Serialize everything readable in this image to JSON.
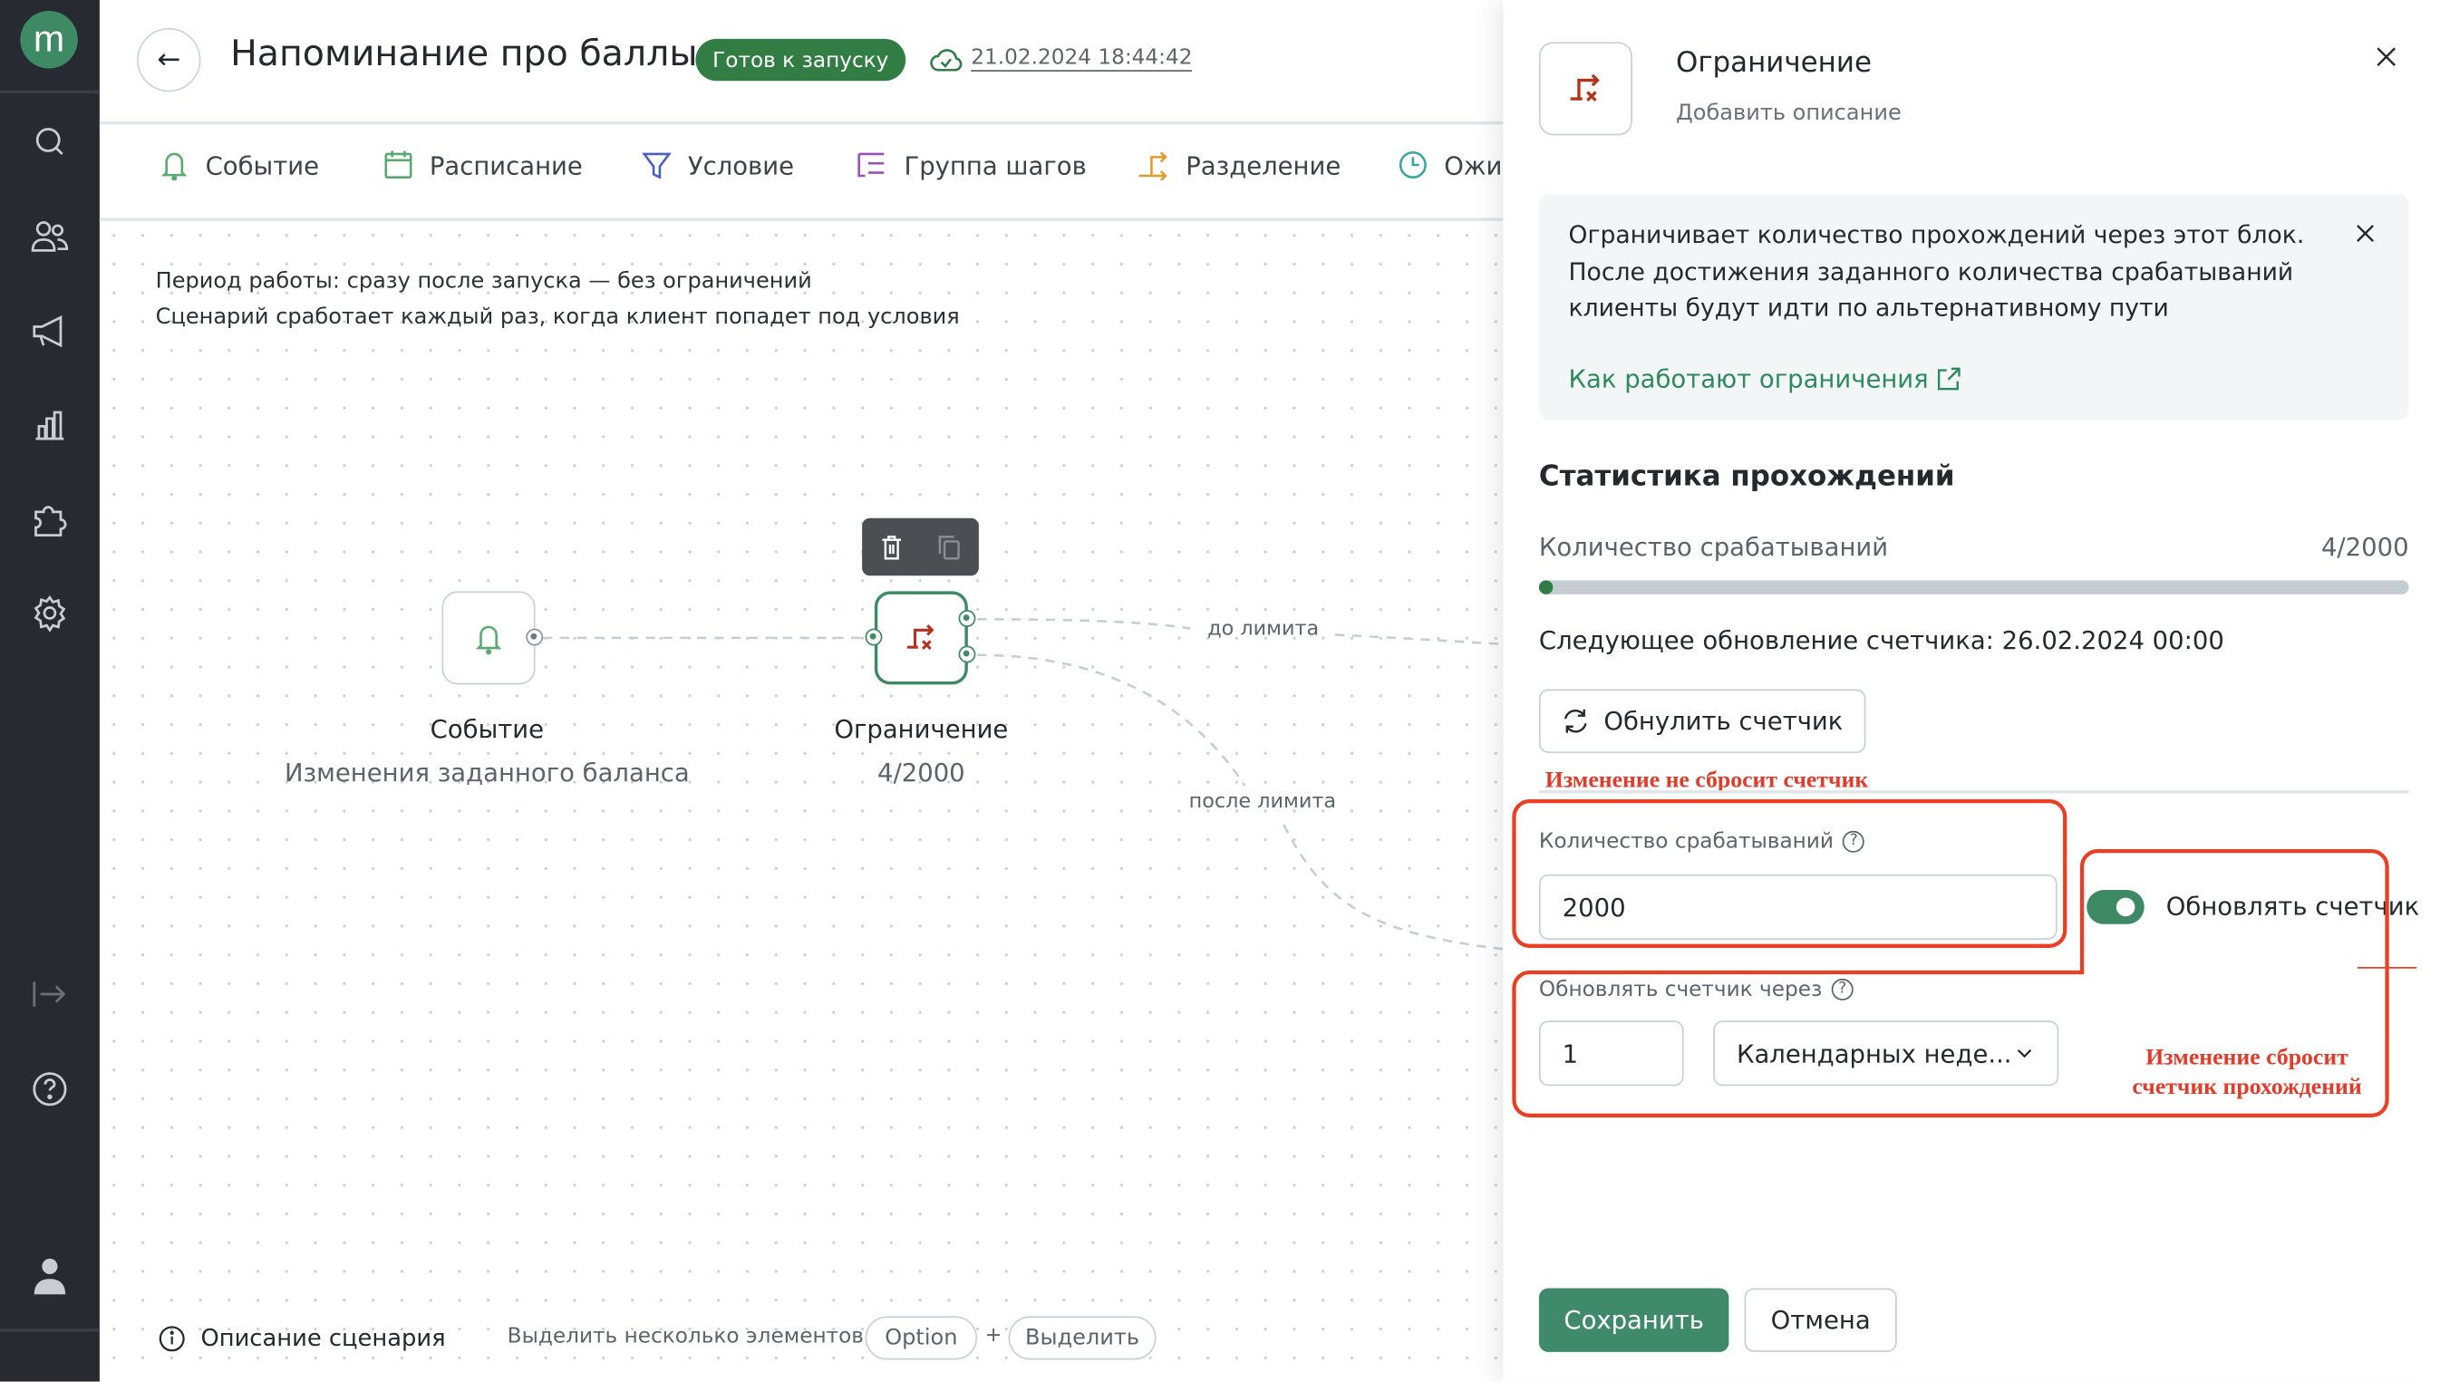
{
  "sidebar": {
    "logo": "m",
    "icons": [
      "search-icon",
      "users-icon",
      "megaphone-icon",
      "chart-icon",
      "puzzle-icon",
      "gear-icon",
      "logout-icon",
      "help-icon",
      "user-icon"
    ]
  },
  "header": {
    "title": "Напоминание про баллы",
    "status": "Готов к запуску",
    "saved_at": "21.02.2024 18:44:42"
  },
  "tabs": [
    {
      "label": "Событие",
      "color": "#5aa96f"
    },
    {
      "label": "Расписание",
      "color": "#5aa96f"
    },
    {
      "label": "Условие",
      "color": "#4a5fc1"
    },
    {
      "label": "Группа шагов",
      "color": "#9b4fb8"
    },
    {
      "label": "Разделение",
      "color": "#e39a2a"
    },
    {
      "label": "Ожи",
      "color": "#3aa3a3"
    }
  ],
  "canvas": {
    "period": "Период работы: сразу после запуска — без ограничений",
    "trigger": "Сценарий сработает каждый раз, когда клиент попадет под условия",
    "nodes": [
      {
        "title": "Событие",
        "subtitle": "Изменения заданного баланса"
      },
      {
        "title": "Ограничение",
        "subtitle": "4/2000"
      }
    ],
    "edges": {
      "before": "до лимита",
      "after": "после лимита"
    }
  },
  "footer": {
    "description": "Описание сценария",
    "multi_select": "Выделить несколько элементов",
    "key": "Option",
    "plus": "+",
    "action": "Выделить"
  },
  "panel": {
    "title": "Ограничение",
    "description_placeholder": "Добавить описание",
    "info": {
      "lines": [
        "Ограничивает количество прохождений через этот блок.",
        "После достижения заданного количества срабатываний",
        "клиенты будут идти по альтернативному пути"
      ],
      "link": "Как работают ограничения"
    },
    "stats": {
      "heading": "Статистика прохождений",
      "label": "Количество срабатываний",
      "value": "4/2000",
      "progress": 0.002,
      "next_update": "Следующее обновление счетчика: 26.02.2024 00:00",
      "reset": "Обнулить счетчик"
    },
    "form": {
      "limit_label": "Количество срабатываний",
      "limit_value": "2000",
      "toggle_label": "Обновлять счетчик",
      "toggle_on": true,
      "period_label": "Обновлять счетчик через",
      "period_value": "1",
      "period_unit": "Календарных неде..."
    },
    "annotations": {
      "no_reset": "Изменение не сбросит счетчик",
      "reset_1": "Изменение сбросит",
      "reset_2": "счетчик прохождений",
      "color": "#e23b2a"
    },
    "save": "Сохранить",
    "cancel": "Отмена"
  },
  "colors": {
    "accent": "#3d8a65",
    "badge": "#317d44",
    "sidebar": "#272a30"
  }
}
